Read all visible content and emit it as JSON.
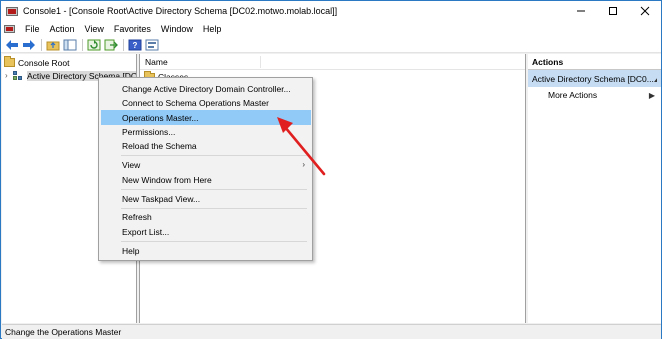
{
  "window": {
    "title": "Console1 - [Console Root\\Active Directory Schema [DC02.motwo.molab.local]]",
    "controls": [
      "minimize",
      "maximize",
      "close"
    ]
  },
  "menubar": {
    "items": [
      "File",
      "Action",
      "View",
      "Favorites",
      "Window",
      "Help"
    ]
  },
  "toolbar": {
    "icons": [
      "back-arrow-icon",
      "forward-arrow-icon",
      "up-folder-icon",
      "show-hide-tree-icon",
      "refresh-icon",
      "export-list-icon",
      "help-icon",
      "properties-icon"
    ]
  },
  "tree": {
    "root_label": "Console Root",
    "schema_label": "Active Directory Schema [DC0"
  },
  "center": {
    "column_name": "Name",
    "first_item": "Classes"
  },
  "actions": {
    "header": "Actions",
    "section_label": "Active Directory Schema [DC0...",
    "more_actions": "More Actions"
  },
  "context_menu": {
    "items": [
      "Change Active Directory Domain Controller...",
      "Connect to Schema Operations Master",
      "Operations Master...",
      "Permissions...",
      "Reload the Schema",
      "View",
      "New Window from Here",
      "New Taskpad View...",
      "Refresh",
      "Export List...",
      "Help"
    ],
    "highlighted": "Operations Master..."
  },
  "status": {
    "text": "Change the Operations Master"
  },
  "colors": {
    "highlight": "#91c9f7",
    "actions_section": "#c5dcf3",
    "annotation_arrow": "#e02020",
    "window_border": "#2b79c2"
  }
}
